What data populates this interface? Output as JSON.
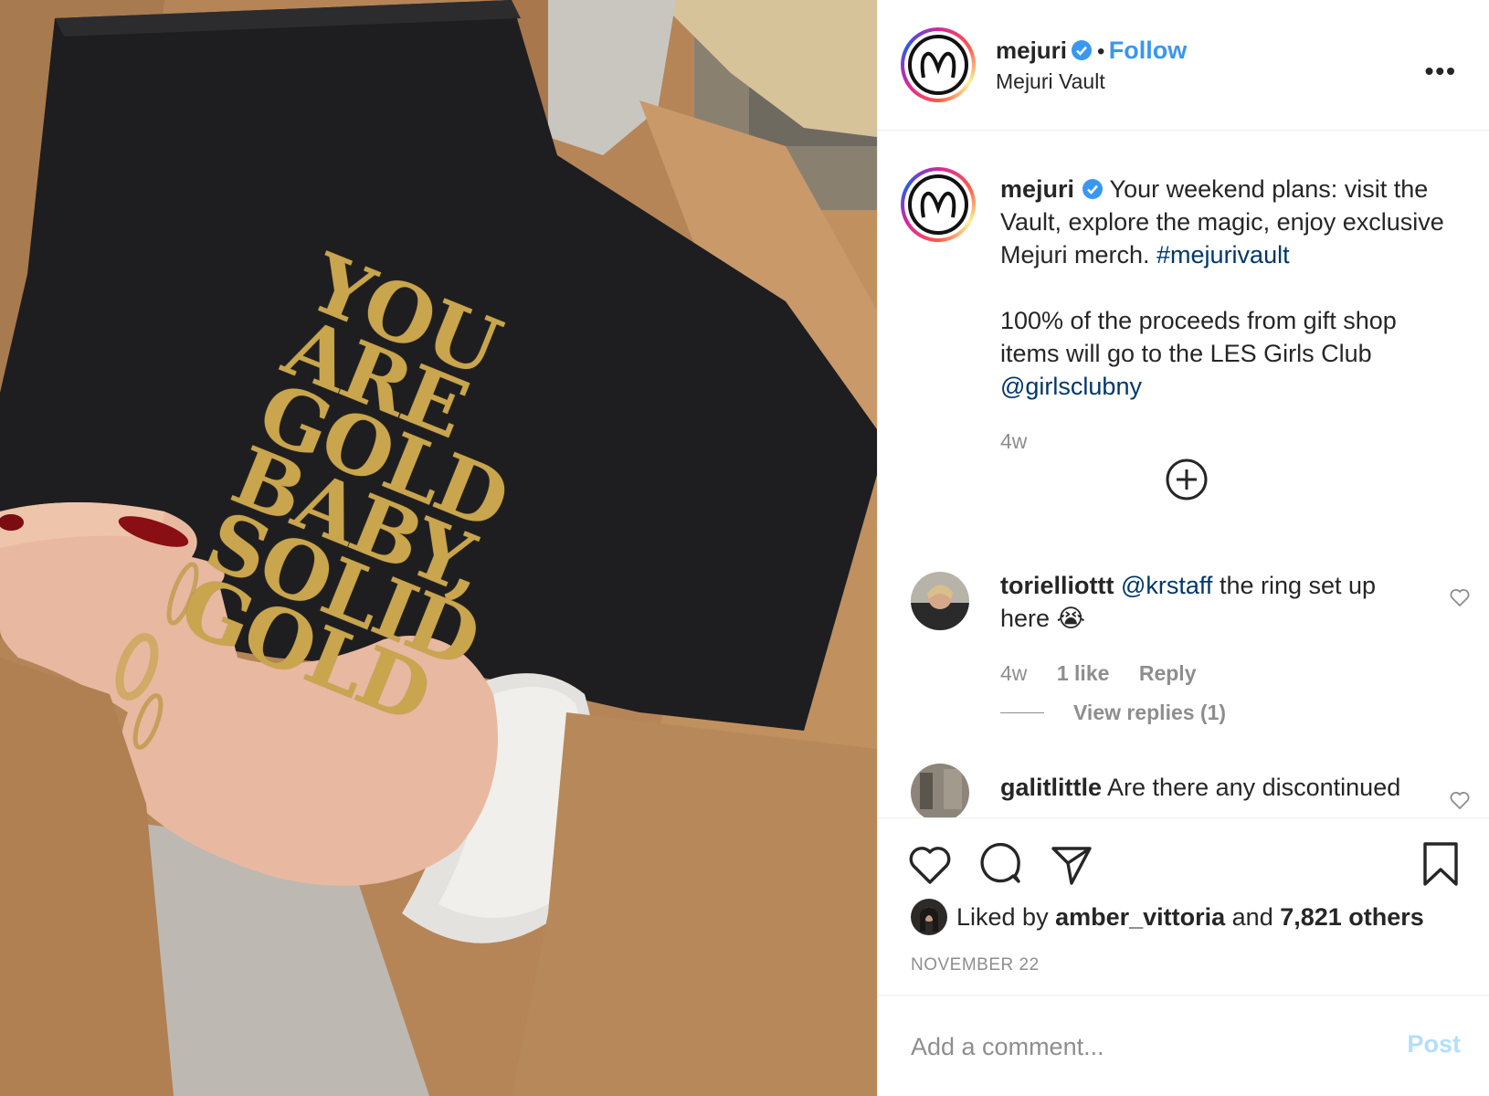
{
  "post": {
    "account": {
      "username": "mejuri",
      "verified": true,
      "follow_label": "Follow",
      "separator": "•",
      "location": "Mejuri Vault",
      "more_label": "•••"
    },
    "photo": {
      "bag_text_lines": [
        "YOU",
        "ARE",
        "GOLD",
        "BABY,",
        "SOLID",
        "GOLD"
      ]
    },
    "caption": {
      "username": "mejuri",
      "text_part1": " Your weekend plans: visit the Vault, explore the magic, enjoy exclusive Mejuri merch. ",
      "hashtag": "#mejurivault",
      "text_part2": "100% of the proceeds from gift shop items will go to the LES Girls Club ",
      "mention": "@girlsclubny",
      "time": "4w"
    },
    "load_more_icon": "plus-circle-icon",
    "comments": [
      {
        "username": "torielliottt",
        "mention": "@krstaff",
        "text": " the ring set up here 😭",
        "time": "4w",
        "likes": "1 like",
        "reply_label": "Reply",
        "view_replies": "View replies (1)"
      },
      {
        "username": "galitlittle",
        "text": " Are there any discontinued"
      }
    ],
    "actions": {
      "like_icon": "heart-icon",
      "comment_icon": "comment-icon",
      "share_icon": "paper-plane-icon",
      "save_icon": "bookmark-icon"
    },
    "likes": {
      "prefix": "Liked by ",
      "liker": "amber_vittoria",
      "middle": " and ",
      "others": "7,821 others"
    },
    "date": "NOVEMBER 22",
    "add_comment": {
      "placeholder": "Add a comment...",
      "post_label": "Post"
    }
  },
  "colors": {
    "follow_blue": "#3897f0",
    "link_blue": "#00376b",
    "muted_gray": "#8e8e8e",
    "post_disabled": "#b2dffc",
    "verified_blue": "#3897f0"
  }
}
